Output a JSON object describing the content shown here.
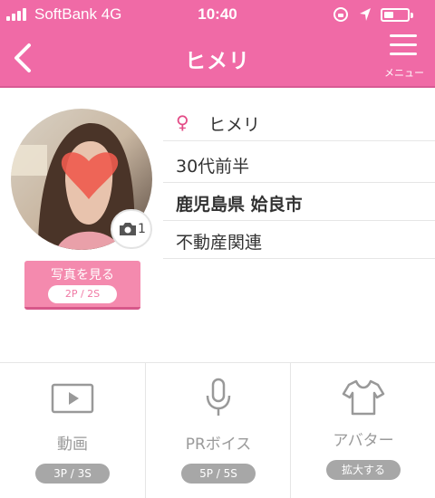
{
  "status_bar": {
    "carrier": "SoftBank  4G",
    "time": "10:40"
  },
  "header": {
    "title": "ヒメリ",
    "menu_label": "メニュー"
  },
  "profile": {
    "name": "ヒメリ",
    "gender_symbol": "♀",
    "age": "30代前半",
    "region": "鹿児島県 姶良市",
    "occupation": "不動産関連",
    "photo_count": "1",
    "view_photos_label": "写真を見る",
    "view_photos_cost": "2P / 2S"
  },
  "actions": [
    {
      "label": "動画",
      "cost": "3P / 3S",
      "icon": "video-icon"
    },
    {
      "label": "PRボイス",
      "cost": "5P / 5S",
      "icon": "microphone-icon"
    },
    {
      "label": "アバター",
      "cost": "拡大する",
      "icon": "tshirt-icon"
    }
  ],
  "colors": {
    "header": "#f06aa6",
    "button": "#f48aae",
    "gender": "#e34b86",
    "pill_gray": "#a7a7a7"
  }
}
